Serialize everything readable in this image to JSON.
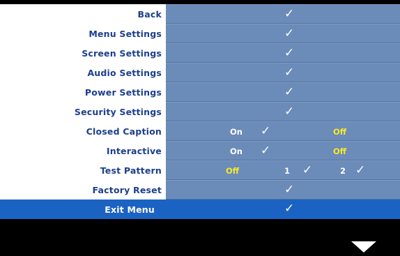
{
  "menu": {
    "items": [
      {
        "label": "Back",
        "check": "✓"
      },
      {
        "label": "Menu Settings",
        "check": "✓"
      },
      {
        "label": "Screen Settings",
        "check": "✓"
      },
      {
        "label": "Audio Settings",
        "check": "✓"
      },
      {
        "label": "Power Settings",
        "check": "✓"
      },
      {
        "label": "Security Settings",
        "check": "✓"
      }
    ],
    "closed_caption": {
      "label": "Closed Caption",
      "on": "On",
      "off": "Off",
      "check": "✓",
      "selected": "On"
    },
    "interactive": {
      "label": "Interactive",
      "on": "On",
      "off": "Off",
      "check": "✓",
      "selected": "On"
    },
    "test_pattern": {
      "label": "Test Pattern",
      "off": "Off",
      "opt1": "1",
      "opt2": "2",
      "check1": "✓",
      "check2": "✓"
    },
    "factory_reset": {
      "label": "Factory Reset",
      "check": "✓"
    },
    "exit_menu": {
      "label": "Exit Menu",
      "check": "✓"
    }
  },
  "colors": {
    "label_text": "#1d3f8c",
    "value_bg": "#6b8bb8",
    "highlight_bg": "#1b63c3",
    "active_option": "#f8e928"
  },
  "icons": {
    "check": "check-icon",
    "scroll_down": "down-arrow-icon"
  }
}
